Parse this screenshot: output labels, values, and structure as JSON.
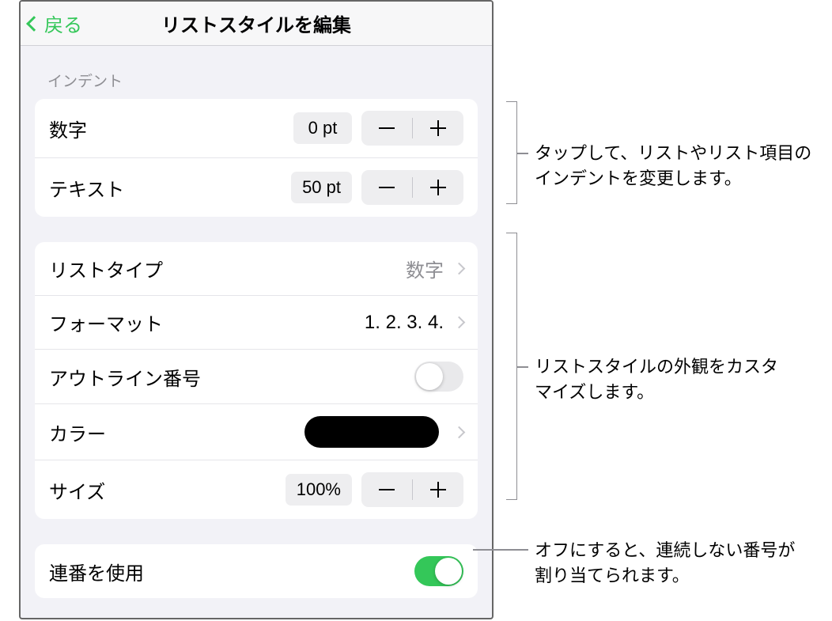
{
  "header": {
    "back": "戻る",
    "title": "リストスタイルを編集"
  },
  "sections": {
    "indent_title": "インデント",
    "indent": {
      "number_label": "数字",
      "number_value": "0 pt",
      "text_label": "テキスト",
      "text_value": "50 pt"
    },
    "style": {
      "list_type_label": "リストタイプ",
      "list_type_value": "数字",
      "format_label": "フォーマット",
      "format_value": "1. 2. 3. 4.",
      "outline_label": "アウトライン番号",
      "outline_on": false,
      "color_label": "カラー",
      "color_value": "#000000",
      "size_label": "サイズ",
      "size_value": "100%"
    },
    "sequential": {
      "label": "連番を使用",
      "on": true
    }
  },
  "callouts": {
    "indent": "タップして、リストやリスト項目のインデントを変更します。",
    "style": "リストスタイルの外観をカスタマイズします。",
    "sequential": "オフにすると、連続しない番号が割り当てられます。"
  }
}
